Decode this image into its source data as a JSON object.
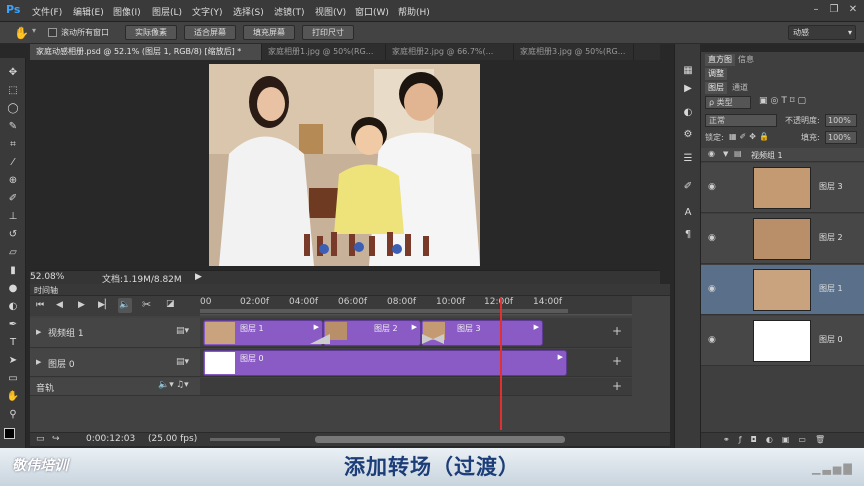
{
  "app": {
    "logo": "Ps"
  },
  "menu": [
    "文件(F)",
    "编辑(E)",
    "图像(I)",
    "图层(L)",
    "文字(Y)",
    "选择(S)",
    "滤镜(T)",
    "视图(V)",
    "窗口(W)",
    "帮助(H)"
  ],
  "options_bar": {
    "scroll_all_label": "滚动所有窗口",
    "buttons": [
      "实际像素",
      "适合屏幕",
      "填充屏幕",
      "打印尺寸"
    ],
    "workspace": "动感"
  },
  "doc_tabs": [
    "家庭动感相册.psd @ 52.1% (图层 1, RGB/8) [缩放后] *",
    "家庭相册1.jpg @ 50%(RG...",
    "家庭相册2.jpg @ 66.7%(...",
    "家庭相册3.jpg @ 50%(RG..."
  ],
  "status": {
    "zoom": "52.08%",
    "doc_size": "文档:1.19M/8.82M"
  },
  "timeline": {
    "title": "时间轴",
    "ruler_marks": [
      "00",
      "02:00f",
      "04:00f",
      "06:00f",
      "08:00f",
      "10:00f",
      "12:00f",
      "14:00f"
    ],
    "playhead_fraction": 0.868,
    "tracks": [
      {
        "name": "视频组 1",
        "clips": [
          "图层 1",
          "图层 2",
          "图层 3"
        ]
      },
      {
        "name": "图层 0",
        "clips": [
          "图层 0"
        ]
      },
      {
        "name": "音轨",
        "clips": []
      }
    ],
    "timecode": "0:00:12:03",
    "fps": "(25.00 fps)"
  },
  "panels": {
    "tabs_top": [
      "直方图",
      "信息"
    ],
    "adjust_tab": "调整",
    "layer_tabs": [
      "图层",
      "通道"
    ],
    "filter_kind": "ρ 类型",
    "blend_mode": "正常",
    "opacity_label": "不透明度:",
    "opacity_value": "100%",
    "lock_label": "锁定:",
    "fill_label": "填充:",
    "fill_value": "100%",
    "group_name": "视频组 1",
    "layers": [
      "图层 3",
      "图层 2",
      "图层 1",
      "图层 0"
    ]
  },
  "banner": {
    "brand": "敬伟培训",
    "caption": "添加转场（过渡）"
  },
  "colors": {
    "clip": "#8a5bc4",
    "playhead": "#e03030",
    "selected_layer": "#5a6f8a",
    "banner_text": "#1c3d78"
  },
  "icons": [
    "hand-icon",
    "move-icon",
    "marquee-icon",
    "lasso-icon",
    "crop-icon",
    "eyedropper-icon",
    "brush-icon",
    "stamp-icon",
    "eraser-icon",
    "gradient-icon",
    "dodge-icon",
    "pen-icon",
    "type-icon",
    "path-select-icon",
    "shape-icon",
    "zoom-icon",
    "eye-icon",
    "play-icon",
    "scissors-icon",
    "speaker-icon"
  ]
}
